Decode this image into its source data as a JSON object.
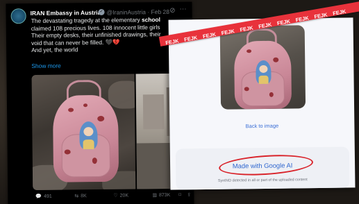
{
  "tweet": {
    "author_name": "IRAN Embassy in Austria",
    "handle_date": "@IraninAustria · Feb 28",
    "lines": [
      [
        "The devastating tragedy at the elementary ",
        "school"
      ],
      [
        "claimed 108 precious lives. 108 innocent little girls",
        ""
      ],
      [
        "Their empty desks, their unfinished drawings, their",
        ""
      ],
      [
        "void that can never be filled. 🖤💔",
        ""
      ],
      [
        "And yet, the world",
        ""
      ]
    ],
    "show_more": "Show more",
    "actions": {
      "replies": "491",
      "reposts": "8K",
      "likes": "20K",
      "views": "873K"
    }
  },
  "panel": {
    "back_to_image": "Back to image",
    "made_with": "Made with Google AI",
    "synthid_note": "SynthID detected in all or part of the uploaded content"
  },
  "tape": {
    "label": "FEJK",
    "color": "#e8323b"
  },
  "colors": {
    "link_blue": "#1d9bf0",
    "accent_blue": "#2f66cf",
    "annotation_red": "#d9232a"
  }
}
